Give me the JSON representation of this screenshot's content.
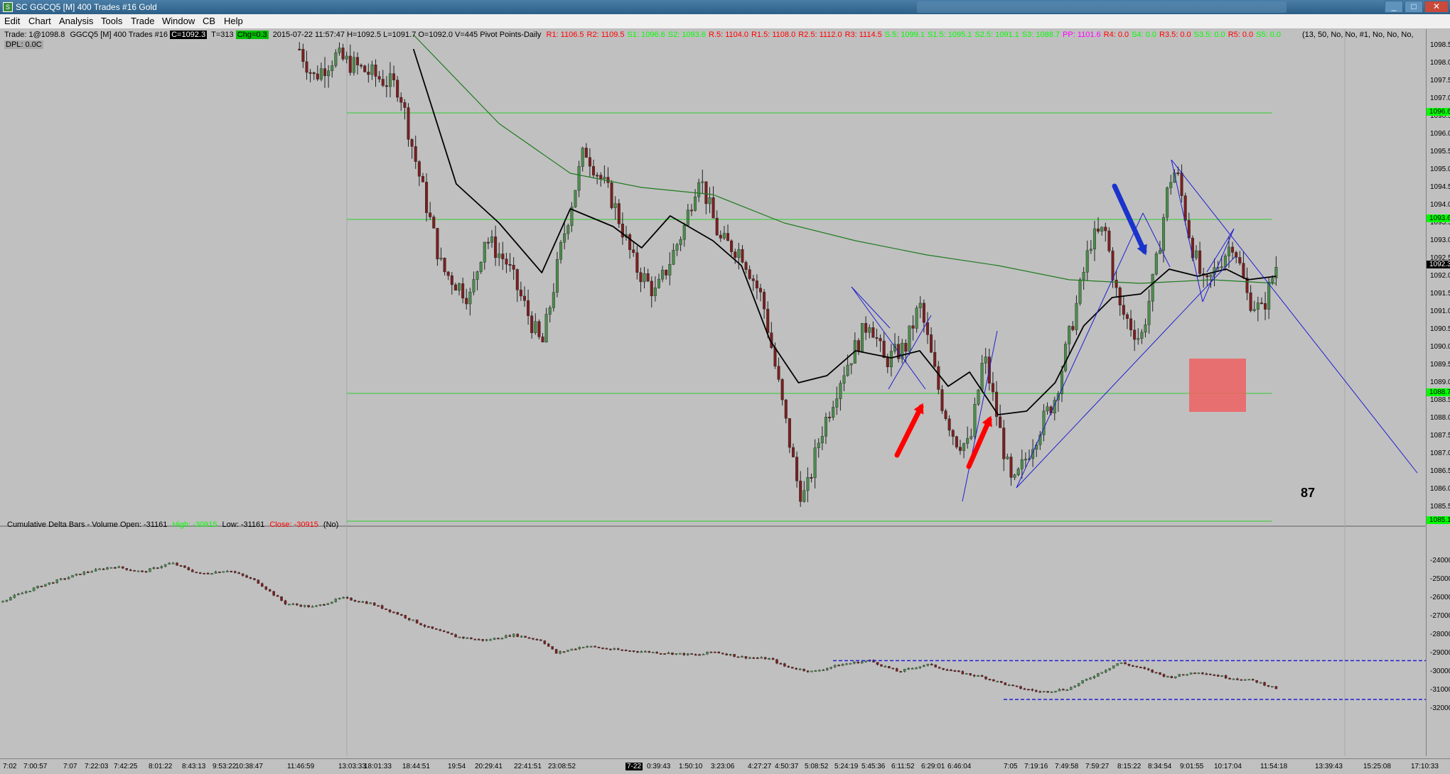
{
  "window": {
    "title": "SC GGCQ5 [M]  400 Trades  #16  Gold",
    "icon": "chart-app-icon",
    "buttons": {
      "min": "_",
      "max": "□",
      "close": "✕"
    }
  },
  "menu": [
    "Edit",
    "Chart",
    "Analysis",
    "Tools",
    "Trade",
    "Window",
    "CB",
    "Help"
  ],
  "header": {
    "trade": "Trade: 1@1098.8",
    "symbol": "GGCQ5 [M]  400 Trades  #16",
    "close_tag": "C=1092.3",
    "ticks": "T=313",
    "chg_tag": "Chg=0.3",
    "info": "2015-07-22 11:57:47 H=1092.5 L=1091.7 O=1092.0 V=445 Pivot Points-Daily",
    "dpl": "DPL: 0.0C",
    "pivots": [
      {
        "t": "R1: 1106.5",
        "c": "#ff0000"
      },
      {
        "t": "R2: 1109.5",
        "c": "#ff0000"
      },
      {
        "t": "S1: 1096.6",
        "c": "#00ff00"
      },
      {
        "t": "S2: 1093.6",
        "c": "#00ff00"
      },
      {
        "t": "R.5: 1104.0",
        "c": "#ff0000"
      },
      {
        "t": "R1.5: 1108.0",
        "c": "#ff0000"
      },
      {
        "t": "R2.5: 1112.0",
        "c": "#ff0000"
      },
      {
        "t": "R3: 1114.5",
        "c": "#ff0000"
      },
      {
        "t": "S.5: 1099.1",
        "c": "#00ff00"
      },
      {
        "t": "S1.5: 1095.1",
        "c": "#00ff00"
      },
      {
        "t": "S2.5: 1091.1",
        "c": "#00ff00"
      },
      {
        "t": "S3: 1088.7",
        "c": "#00ff00"
      },
      {
        "t": "PP: 1101.6",
        "c": "#ff00ff"
      },
      {
        "t": "R4: 0.0",
        "c": "#ff0000"
      },
      {
        "t": "S4: 0.0",
        "c": "#00ff00"
      },
      {
        "t": "R3.5: 0.0",
        "c": "#ff0000"
      },
      {
        "t": "S3.5: 0.0",
        "c": "#00ff00"
      },
      {
        "t": "R5: 0.0",
        "c": "#ff0000"
      },
      {
        "t": "S5: 0.0",
        "c": "#00ff00"
      }
    ],
    "params": "(13, 50, No, No, #1, No, No, No,"
  },
  "lower_header": {
    "label": "Cumulative Delta Bars - Volume  Open: -31161",
    "high": "High: -30915",
    "low": "Low: -31161",
    "close": "Close: -30915",
    "suffix": "(No)"
  },
  "annotation_number": "87",
  "price_axis": {
    "labels": [
      "1098.5",
      "1098.0",
      "1097.5",
      "1097.0",
      "1096.5",
      "1096.0",
      "1095.5",
      "1095.0",
      "1094.5",
      "1094.0",
      "1093.5",
      "1093.0",
      "1092.5",
      "1092.0",
      "1091.5",
      "1091.0",
      "1090.5",
      "1090.0",
      "1089.5",
      "1089.0",
      "1088.5",
      "1088.0",
      "1087.5",
      "1087.0",
      "1086.5",
      "1086.0",
      "1085.5"
    ],
    "highlights": [
      {
        "t": "1096.6",
        "c": "#00ff00"
      },
      {
        "t": "1093.6",
        "c": "#00ff00"
      },
      {
        "t": "1092.3",
        "c": "#000000"
      },
      {
        "t": "1088.7",
        "c": "#00ff00"
      },
      {
        "t": "1085.1",
        "c": "#00ff00"
      }
    ]
  },
  "vol_axis": {
    "labels": [
      "-24000",
      "-25000",
      "-26000",
      "-27000",
      "-28000",
      "-29000",
      "-30000",
      "-31000",
      "-32000"
    ]
  },
  "time_axis": [
    "7:02",
    "7:00:57",
    "7:07",
    "7:22:03",
    "7:42:25",
    "8:01:22",
    "8:43:13",
    "9:53:22",
    "10:38:47",
    "11:46:59",
    "13:03:33",
    "18:01:33",
    "18:44:51",
    "19:54",
    "20:29:41",
    "22:41:51",
    "23:08:52",
    "7-22",
    "0:39:43",
    "1:50:10",
    "3:23:06",
    "4:27:27",
    "4:50:37",
    "5:08:52",
    "5:24:19",
    "5:45:36",
    "6:11:52",
    "6:29:01",
    "6:46:04",
    "7:05",
    "7:19:16",
    "7:49:58",
    "7:59:27",
    "8:15:22",
    "8:34:54",
    "9:01:55",
    "10:17:04",
    "11:54:18",
    "13:39:43",
    "15:25:08",
    "17:10:33"
  ],
  "colors": {
    "background": "#c0c0c0",
    "up_candle": "#4d8b4d",
    "down_candle": "#7a1f1f",
    "ema_fast": "#000000",
    "ema_slow": "#1f7a1f",
    "pivot_line": "#2ecc2e",
    "trend_line": "#1f1fd0",
    "arrow_red": "#ff0000",
    "arrow_blue": "#1a33cc",
    "zone_box": "#ee6060"
  },
  "chart_data": {
    "type": "candlestick",
    "symbol": "GGCQ5",
    "price_range": [
      1085.0,
      1098.8
    ],
    "pivot_levels": [
      1096.6,
      1093.6,
      1088.7,
      1085.1
    ],
    "last_price": 1092.3,
    "price_path": [
      [
        0.21,
        1098.4
      ],
      [
        0.22,
        1097.6
      ],
      [
        0.235,
        1098.2
      ],
      [
        0.28,
        1097.3
      ],
      [
        0.29,
        1095.5
      ],
      [
        0.31,
        1092.2
      ],
      [
        0.33,
        1091.4
      ],
      [
        0.34,
        1093.1
      ],
      [
        0.355,
        1092.4
      ],
      [
        0.38,
        1090.0
      ],
      [
        0.395,
        1093.1
      ],
      [
        0.41,
        1095.6
      ],
      [
        0.43,
        1094.1
      ],
      [
        0.445,
        1092.3
      ],
      [
        0.46,
        1091.5
      ],
      [
        0.48,
        1093.4
      ],
      [
        0.49,
        1094.9
      ],
      [
        0.505,
        1093.0
      ],
      [
        0.52,
        1092.7
      ],
      [
        0.535,
        1091.3
      ],
      [
        0.55,
        1088.1
      ],
      [
        0.56,
        1086.0
      ],
      [
        0.565,
        1085.8
      ],
      [
        0.575,
        1087.5
      ],
      [
        0.59,
        1089.2
      ],
      [
        0.61,
        1090.8
      ],
      [
        0.62,
        1089.6
      ],
      [
        0.635,
        1090.0
      ],
      [
        0.645,
        1091.2
      ],
      [
        0.66,
        1088.5
      ],
      [
        0.67,
        1087.4
      ],
      [
        0.68,
        1087.2
      ],
      [
        0.69,
        1089.8
      ],
      [
        0.7,
        1087.9
      ],
      [
        0.705,
        1086.9
      ],
      [
        0.71,
        1086.0
      ],
      [
        0.725,
        1087.4
      ],
      [
        0.74,
        1088.6
      ],
      [
        0.755,
        1091.2
      ],
      [
        0.765,
        1093.0
      ],
      [
        0.775,
        1093.3
      ],
      [
        0.785,
        1091.1
      ],
      [
        0.8,
        1090.2
      ],
      [
        0.81,
        1092.1
      ],
      [
        0.82,
        1094.7
      ],
      [
        0.825,
        1095.0
      ],
      [
        0.835,
        1093.0
      ],
      [
        0.845,
        1091.6
      ],
      [
        0.855,
        1092.4
      ],
      [
        0.865,
        1093.0
      ],
      [
        0.875,
        1091.4
      ],
      [
        0.885,
        1091.0
      ],
      [
        0.895,
        1092.3
      ]
    ],
    "ema_fast": [
      [
        0.29,
        1098.4
      ],
      [
        0.32,
        1094.6
      ],
      [
        0.35,
        1093.5
      ],
      [
        0.38,
        1092.1
      ],
      [
        0.4,
        1093.9
      ],
      [
        0.43,
        1093.4
      ],
      [
        0.45,
        1092.8
      ],
      [
        0.47,
        1093.7
      ],
      [
        0.5,
        1093.0
      ],
      [
        0.52,
        1092.3
      ],
      [
        0.54,
        1090.2
      ],
      [
        0.56,
        1089.0
      ],
      [
        0.58,
        1089.2
      ],
      [
        0.6,
        1089.9
      ],
      [
        0.625,
        1089.7
      ],
      [
        0.645,
        1089.9
      ],
      [
        0.665,
        1088.9
      ],
      [
        0.68,
        1089.3
      ],
      [
        0.7,
        1088.1
      ],
      [
        0.72,
        1088.2
      ],
      [
        0.74,
        1089.0
      ],
      [
        0.76,
        1090.6
      ],
      [
        0.78,
        1091.4
      ],
      [
        0.8,
        1091.5
      ],
      [
        0.82,
        1092.2
      ],
      [
        0.84,
        1092.0
      ],
      [
        0.86,
        1092.2
      ],
      [
        0.875,
        1091.9
      ],
      [
        0.895,
        1092.0
      ]
    ],
    "ema_slow": [
      [
        0.29,
        1098.8
      ],
      [
        0.35,
        1096.3
      ],
      [
        0.4,
        1094.9
      ],
      [
        0.45,
        1094.5
      ],
      [
        0.5,
        1094.3
      ],
      [
        0.55,
        1093.5
      ],
      [
        0.6,
        1093.0
      ],
      [
        0.65,
        1092.6
      ],
      [
        0.7,
        1092.3
      ],
      [
        0.75,
        1091.9
      ],
      [
        0.8,
        1091.8
      ],
      [
        0.85,
        1091.9
      ],
      [
        0.895,
        1091.8
      ]
    ],
    "cumulative_delta": [
      [
        0.0,
        -26200
      ],
      [
        0.03,
        -25300
      ],
      [
        0.06,
        -24600
      ],
      [
        0.08,
        -24300
      ],
      [
        0.1,
        -24600
      ],
      [
        0.12,
        -24100
      ],
      [
        0.14,
        -24700
      ],
      [
        0.16,
        -24500
      ],
      [
        0.18,
        -25100
      ],
      [
        0.2,
        -26300
      ],
      [
        0.22,
        -26500
      ],
      [
        0.24,
        -26000
      ],
      [
        0.26,
        -26300
      ],
      [
        0.28,
        -26900
      ],
      [
        0.3,
        -27600
      ],
      [
        0.32,
        -28100
      ],
      [
        0.34,
        -28300
      ],
      [
        0.36,
        -28000
      ],
      [
        0.38,
        -28300
      ],
      [
        0.39,
        -29000
      ],
      [
        0.41,
        -28600
      ],
      [
        0.43,
        -28800
      ],
      [
        0.45,
        -28900
      ],
      [
        0.47,
        -29000
      ],
      [
        0.49,
        -29100
      ],
      [
        0.5,
        -28900
      ],
      [
        0.52,
        -29200
      ],
      [
        0.54,
        -29300
      ],
      [
        0.55,
        -29700
      ],
      [
        0.57,
        -30000
      ],
      [
        0.59,
        -29600
      ],
      [
        0.61,
        -29400
      ],
      [
        0.63,
        -30000
      ],
      [
        0.65,
        -29600
      ],
      [
        0.67,
        -30000
      ],
      [
        0.69,
        -30300
      ],
      [
        0.71,
        -30800
      ],
      [
        0.73,
        -31100
      ],
      [
        0.75,
        -30900
      ],
      [
        0.77,
        -30100
      ],
      [
        0.785,
        -29500
      ],
      [
        0.8,
        -29800
      ],
      [
        0.82,
        -30300
      ],
      [
        0.84,
        -30000
      ],
      [
        0.86,
        -30300
      ],
      [
        0.88,
        -30500
      ],
      [
        0.895,
        -30900
      ]
    ]
  }
}
